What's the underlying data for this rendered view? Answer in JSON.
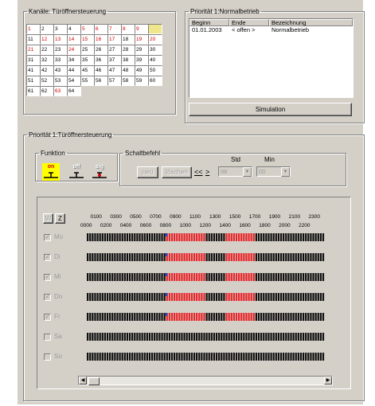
{
  "channels": {
    "title": "Kanäle: Türöffnersteuerung",
    "cells": [
      "1",
      "2",
      "3",
      "4",
      "5",
      "6",
      "7",
      "8",
      "9",
      "",
      "11",
      "12",
      "13",
      "14",
      "15",
      "16",
      "17",
      "18",
      "19",
      "20",
      "21",
      "22",
      "23",
      "24",
      "25",
      "26",
      "27",
      "28",
      "29",
      "30",
      "31",
      "32",
      "33",
      "34",
      "35",
      "36",
      "37",
      "38",
      "39",
      "40",
      "41",
      "42",
      "43",
      "44",
      "45",
      "46",
      "47",
      "48",
      "49",
      "50",
      "51",
      "52",
      "53",
      "54",
      "55",
      "56",
      "57",
      "58",
      "59",
      "60",
      "61",
      "62",
      "63",
      "64"
    ],
    "red_cells": [
      "1",
      "5",
      "6",
      "7",
      "8",
      "9",
      "12",
      "13",
      "14",
      "15",
      "16",
      "17",
      "19",
      "20",
      "21",
      "24",
      "63"
    ]
  },
  "priority_top": {
    "title": "Priorität 1:Normalbetrieb",
    "columns": [
      "Beginn",
      "Ende",
      "Bezeichnung"
    ],
    "rows": [
      {
        "beginn": "01.01.2003",
        "ende": "< offen >",
        "bezeichnung": "Normalbetrieb"
      }
    ],
    "simulation_label": "Simulation"
  },
  "priority_bottom": {
    "title": "Priorität 1:Türöffnersteuerung"
  },
  "funktion": {
    "title": "Funktion",
    "on_label": "on",
    "off_label": "off",
    "sig_label": "sig"
  },
  "schaltbefehl": {
    "title": "Schaltbefehl",
    "neu_label": "neu",
    "loeschen_label": "löschen",
    "prev_label": "<<",
    "next_label": ">",
    "std_label": "Std",
    "min_label": "Min",
    "std_value": "08",
    "min_value": "00"
  },
  "schedule": {
    "w_label": "W",
    "z_label": "Z",
    "ticks_top": [
      "0100",
      "0300",
      "0500",
      "0700",
      "0900",
      "1100",
      "1300",
      "1500",
      "1700",
      "1900",
      "2100",
      "2300"
    ],
    "ticks_bottom": [
      "0000",
      "0200",
      "0400",
      "0600",
      "0800",
      "1000",
      "1200",
      "1400",
      "1600",
      "1800",
      "2000",
      "2200"
    ],
    "days": [
      {
        "label": "Mo",
        "checked": true,
        "active_ranges": [
          [
            "08:00",
            "12:00"
          ],
          [
            "14:00",
            "17:00"
          ]
        ]
      },
      {
        "label": "Di",
        "checked": true,
        "active_ranges": [
          [
            "08:00",
            "12:00"
          ],
          [
            "14:00",
            "17:00"
          ]
        ]
      },
      {
        "label": "Mi",
        "checked": true,
        "active_ranges": [
          [
            "08:00",
            "12:00"
          ],
          [
            "14:00",
            "17:00"
          ]
        ]
      },
      {
        "label": "Do",
        "checked": true,
        "active_ranges": [
          [
            "08:00",
            "12:00"
          ],
          [
            "14:00",
            "17:00"
          ]
        ]
      },
      {
        "label": "Fr",
        "checked": true,
        "active_ranges": [
          [
            "08:00",
            "12:00"
          ],
          [
            "14:00",
            "17:00"
          ]
        ]
      },
      {
        "label": "Sa",
        "checked": false,
        "active_ranges": []
      },
      {
        "label": "So",
        "checked": false,
        "active_ranges": []
      }
    ],
    "colors": {
      "active": "#e8252a",
      "inactive": "#111111",
      "marker": "#2050c8"
    }
  }
}
